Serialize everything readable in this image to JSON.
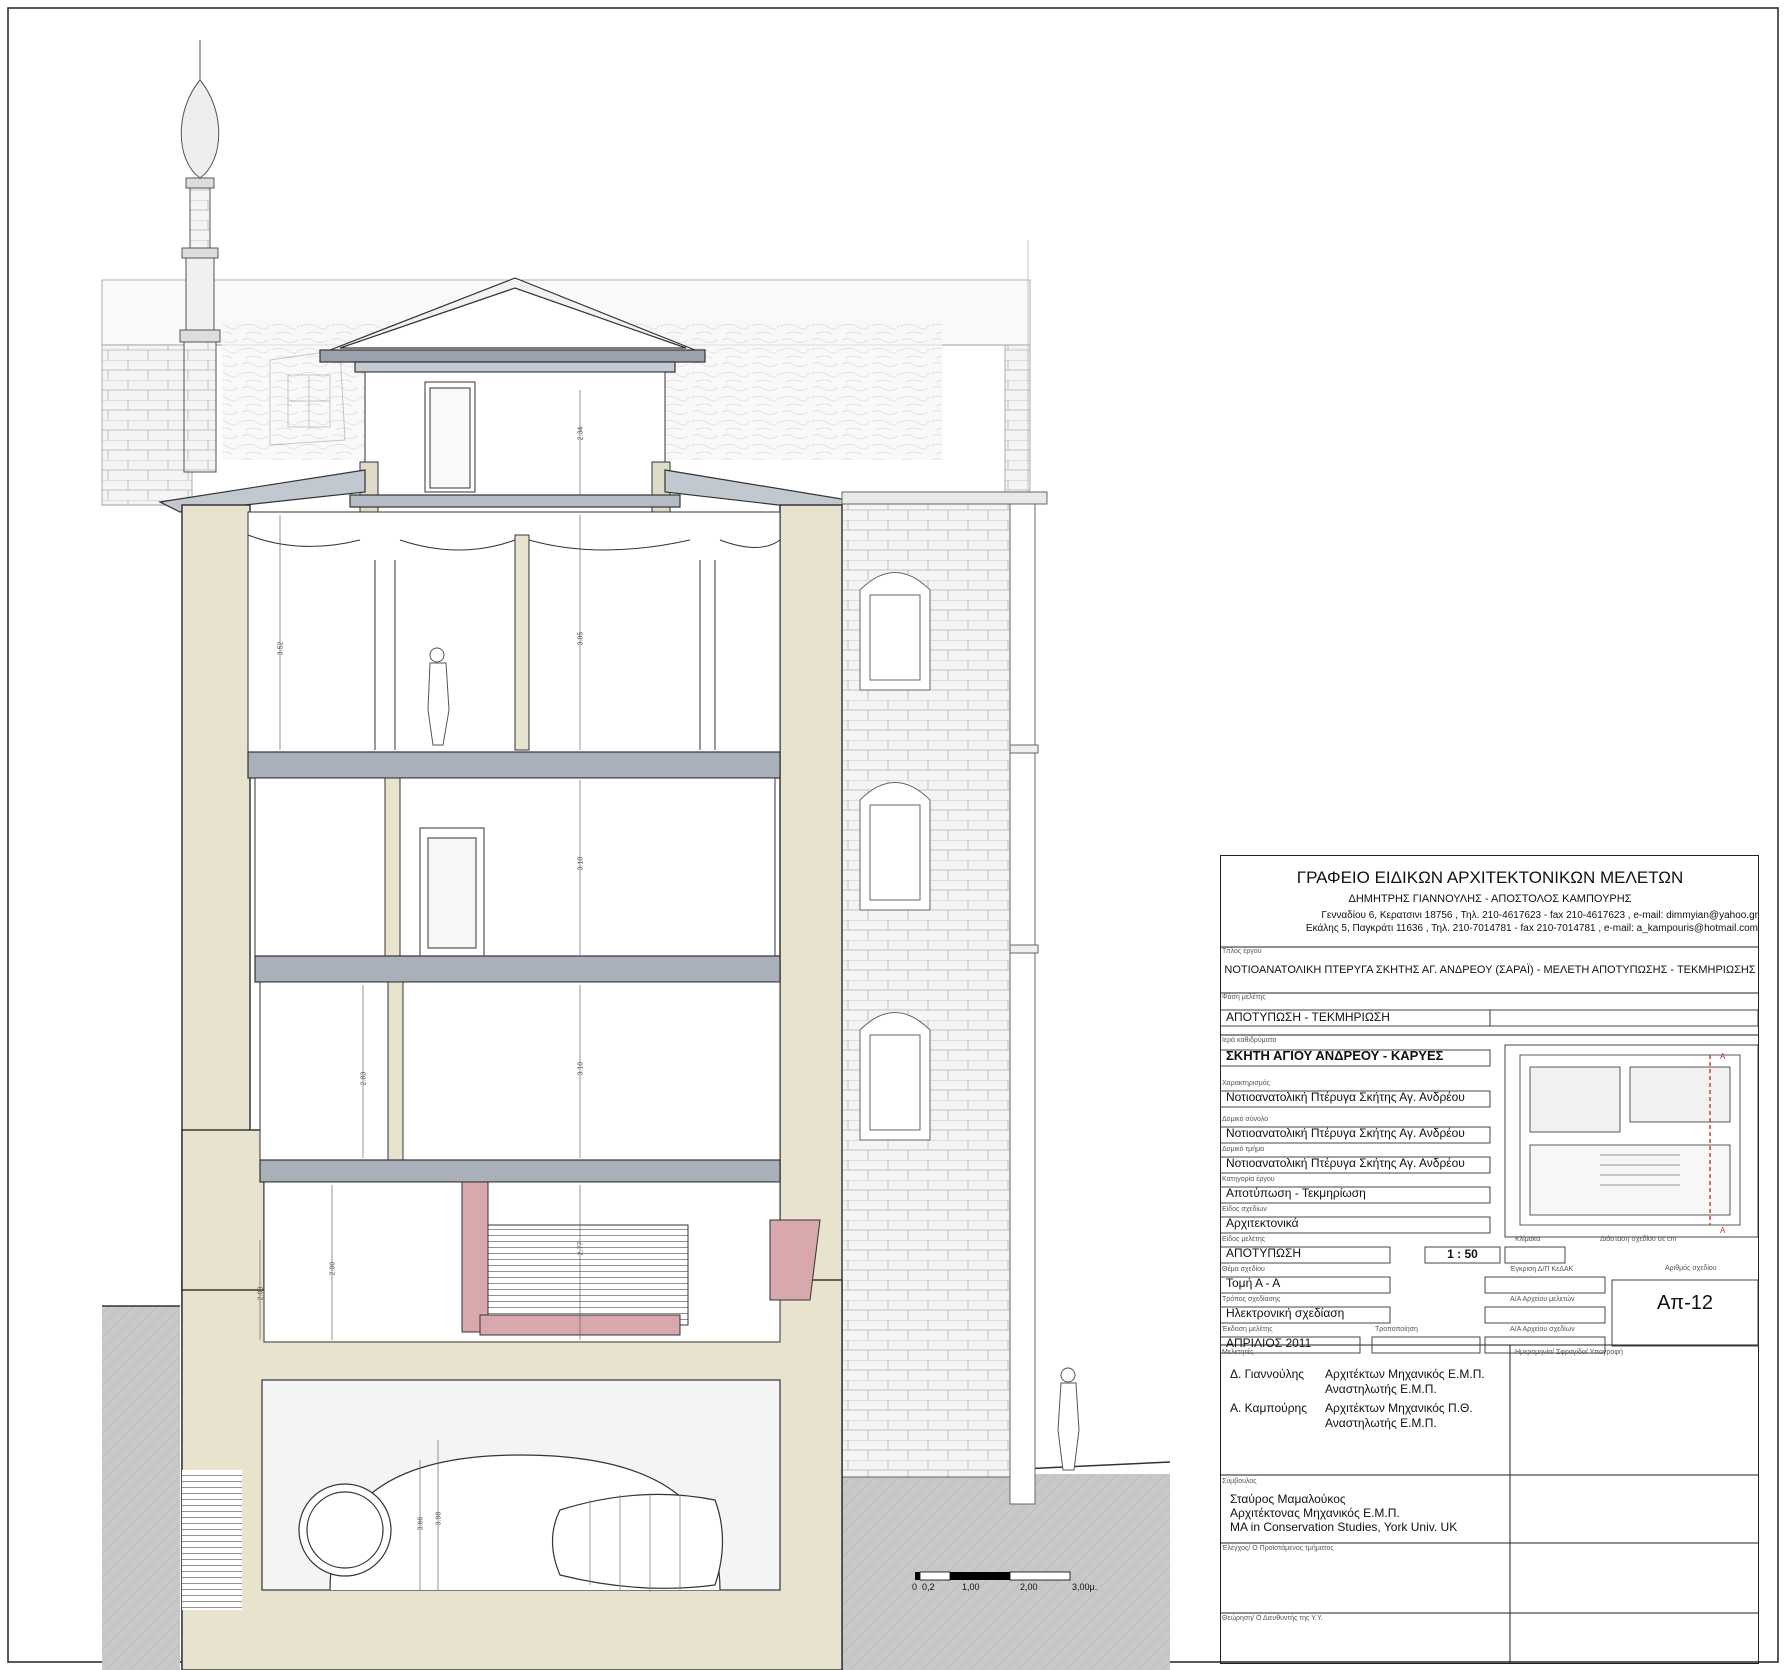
{
  "office": {
    "name": "ΓΡΑΦΕΙΟ ΕΙΔΙΚΩΝ ΑΡΧΙΤΕΚΤΟΝΙΚΩΝ ΜΕΛΕΤΩΝ",
    "partners": "ΔΗΜΗΤΡΗΣ ΓΙΑΝΝΟΥΛΗΣ  -  ΑΠΟΣΤΟΛΟΣ ΚΑΜΠΟΥΡΗΣ",
    "address1": "Γενναδίου 6, Κερατσινι 18756 , Τηλ. 210-4617623 - fax 210-4617623 , e-mail: dimmyian@yahoo.gr",
    "address2": "Εκάλης 5, Παγκράτι 11636 , Τηλ. 210-7014781 - fax 210-7014781 , e-mail: a_kampouris@hotmail.com"
  },
  "fields": {
    "title_label": "Τίτλος έργου",
    "title_value": "ΝΟΤΙΟΑΝΑΤΟΛΙΚΗ ΠΤΕΡΥΓΑ ΣΚΗΤΗΣ ΑΓ. ΑΝΔΡΕΟΥ (ΣΑΡΑΪ) - ΜΕΛΕΤΗ ΑΠΟΤΥΠΩΣΗΣ - ΤΕΚΜΗΡΙΩΣΗΣ",
    "phase_label": "Φάση μελέτης",
    "phase_value": "ΑΠΟΤΥΠΩΣΗ - ΤΕΚΜΗΡΙΩΣΗ",
    "monument_label": "Ιερά καθιδρύματα",
    "monument_value": "ΣΚΗΤΗ ΑΓΙΟΥ ΑΝΔΡΕΟΥ - ΚΑΡΥΕΣ",
    "character_label": "Χαρακτηρισμός",
    "character_value": "Νοτιοανατολική Πτέρυγα Σκήτης Αγ. Ανδρέου",
    "complex_label": "Δομικό σύνολο",
    "complex_value": "Νοτιοανατολική Πτέρυγα Σκήτης Αγ. Ανδρέου",
    "part_label": "Δομικό τμήμα",
    "part_value": "Νοτιοανατολική Πτέρυγα Σκήτης Αγ. Ανδρέου",
    "category_label": "Κατηγορία έργου",
    "category_value": "Αποτύπωση - Τεκμηρίωση",
    "drawing_type_label": "Είδος σχεδίων",
    "drawing_type_value": "Αρχιτεκτονικά",
    "study_type_label": "Είδος μελέτης",
    "study_type_value": "ΑΠΟΤΥΠΩΣΗ",
    "scale_label": "Κλίμακα",
    "scale_value": "1 : 50",
    "dimension_label": "Διάσταση σχεδίου σε cm",
    "subject_label": "Θέμα σχεδίου",
    "subject_value": "Τομή  Α - Α",
    "approval_label": "Έγκριση Δ/Π ΚεΔΑΚ",
    "method_label": "Τρόπος σχεδίασης",
    "method_value": "Ηλεκτρονική σχεδίαση",
    "archive_studies_label": "Α/Α Αρχείου μελετών",
    "drawing_no_label": "Αριθμός σχεδίου",
    "drawing_no_value": "Απ-12",
    "edition_label": "Έκδοση μελέτης",
    "edition_value": "ΑΠΡΙΛΙΟΣ 2011",
    "revision_label": "Τροποποίηση",
    "archive_drawings_label": "Α/Α Αρχείου σχεδίων"
  },
  "team": {
    "designers_label": "Μελετητές",
    "signature_label": "Ημερομηνία/ Σφραγίδα/ Υπογραφή",
    "d1_name": "Δ. Γιαννούλης",
    "d1_line1": "Αρχιτέκτων Μηχανικός Ε.Μ.Π.",
    "d1_line2": "Αναστηλωτής Ε.Μ.Π.",
    "d2_name": "Α. Καμπούρης",
    "d2_line1": "Αρχιτέκτων Μηχανικός Π.Θ.",
    "d2_line2": "Αναστηλωτής Ε.Μ.Π.",
    "consultant_label": "Σύμβουλος",
    "c_name": "Σταύρος  Μαμαλούκος",
    "c_line1": "Αρχιτέκτονας Μηχανικός Ε.Μ.Π.",
    "c_line2": "MA in Conservation Studies, York Univ. UK",
    "check_label": "Έλεγχος/ Ο Προϊστάμενος τμήματος",
    "endorse_label": "Θεώρηση/ Ο Διευθυντής της Υ.Υ."
  },
  "keyplan": {
    "section_marker_top": "Α",
    "section_marker_bottom": "Α"
  },
  "section": {
    "dim_attic": "2.34",
    "dim_f3_left": "3.52",
    "dim_f3_right": "3.85",
    "dim_f2": "3.10",
    "dim_f1_left": "2.83",
    "dim_f1_right": "3.10",
    "dim_g_small": "2.08",
    "dim_g_left": "2.90",
    "dim_g_right": "2.77",
    "dim_b1": "3.98",
    "dim_b2": "3.66"
  },
  "scale_bar": {
    "t0": "0",
    "t1": "0,2",
    "t2": "1,00",
    "t3": "2,00",
    "t4": "3,00μ."
  },
  "colors": {
    "wall": "#e8e3cf",
    "ground": "#c7c7c7",
    "brick": "#d9a8ac",
    "slab": "#a9b0b9",
    "line": "#2a2a2a"
  }
}
